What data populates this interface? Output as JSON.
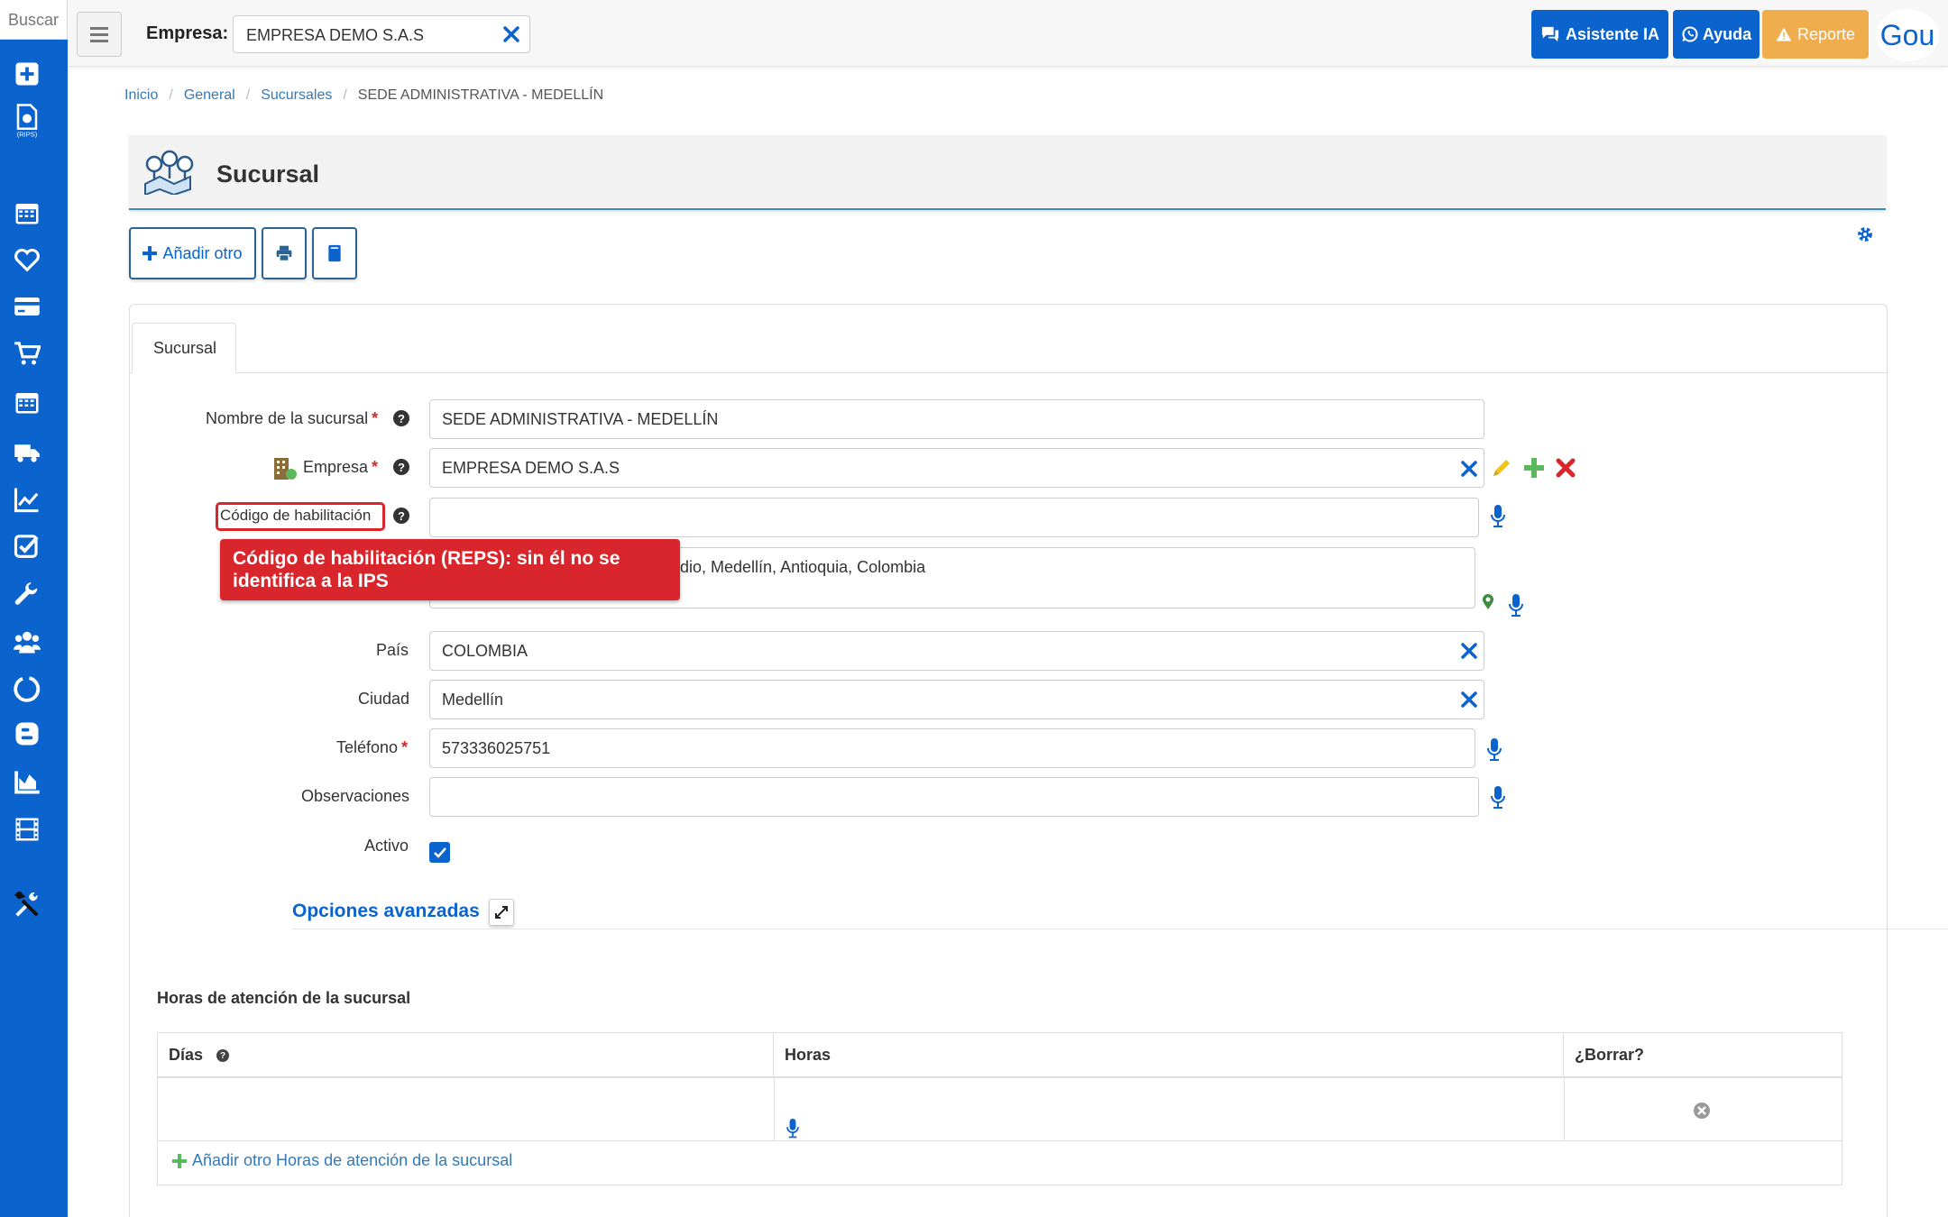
{
  "sidebar": {
    "search_placeholder": "Buscar",
    "icons": [
      "plus-square-icon",
      "rips-file-icon",
      "calendar-icon",
      "heart-icon",
      "credit-card-icon",
      "shopping-cart-icon",
      "calendar-grid-icon",
      "truck-icon",
      "line-chart-icon",
      "check-square-icon",
      "wrench-icon",
      "users-icon",
      "circle-notch-icon",
      "blogger-icon",
      "area-chart-icon",
      "film-icon",
      "tools-icon"
    ]
  },
  "topbar": {
    "empresa_label": "Empresa:",
    "empresa_value": "EMPRESA DEMO S.A.S",
    "asistente_label": "Asistente IA",
    "ayuda_label": "Ayuda",
    "reporte_label": "Reporte",
    "avatar_text": "Gou"
  },
  "breadcrumb": {
    "items": [
      "Inicio",
      "General",
      "Sucursales"
    ],
    "current": "SEDE ADMINISTRATIVA - MEDELLÍN"
  },
  "page": {
    "title": "Sucursal",
    "add_button": "Añadir otro"
  },
  "form": {
    "tab": "Sucursal",
    "nombre_label": "Nombre de la sucursal",
    "nombre_value": "SEDE ADMINISTRATIVA  - MEDELLÍN",
    "empresa_label": "Empresa",
    "empresa_value": "EMPRESA DEMO S.A.S",
    "codigo_label": "Código de habilitación",
    "codigo_value": "",
    "direccion_value": "dio, Medellín, Antioquia, Colombia",
    "pais_label": "País",
    "pais_value": "COLOMBIA",
    "ciudad_label": "Ciudad",
    "ciudad_value": "Medellín",
    "telefono_label": "Teléfono",
    "telefono_value": "573336025751",
    "observaciones_label": "Observaciones",
    "observaciones_value": "",
    "activo_label": "Activo",
    "activo_checked": true,
    "required_mark": "*"
  },
  "tooltip": {
    "text": "Código de habilitación (REPS): sin él no se identifica a la IPS"
  },
  "advanced": {
    "title": "Opciones avanzadas"
  },
  "hours": {
    "title": "Horas de atención de la sucursal",
    "columns": [
      "Días",
      "Horas",
      "¿Borrar?"
    ],
    "add_link": "Añadir otro Horas de atención de la sucursal"
  },
  "colors": {
    "primary": "#0b63ce",
    "warning": "#f0ad4e",
    "danger": "#d9262c",
    "success": "#5cb85c",
    "edit": "#f0c419"
  }
}
